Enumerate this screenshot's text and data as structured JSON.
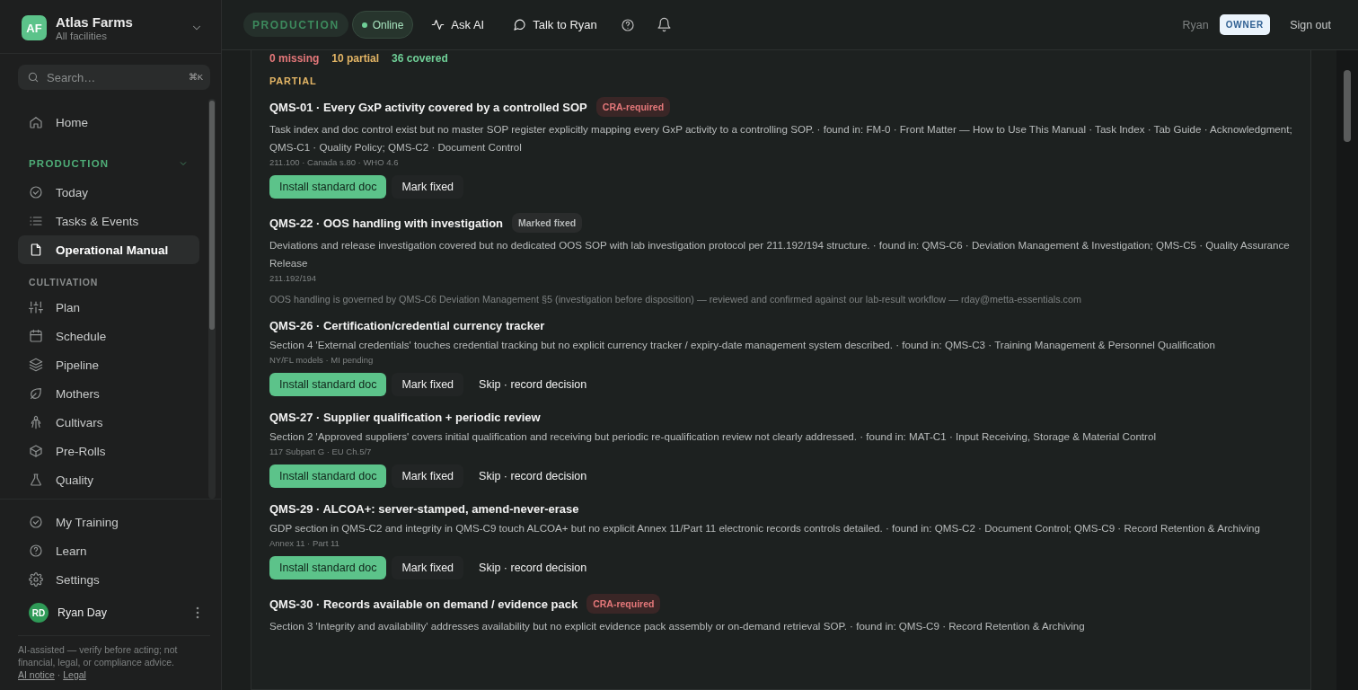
{
  "org": {
    "initials": "AF",
    "name": "Atlas Farms",
    "subtitle": "All facilities"
  },
  "search": {
    "placeholder": "Search…",
    "shortcut": "⌘K"
  },
  "nav": [
    {
      "kind": "item",
      "label": "Home",
      "selected": false
    },
    {
      "kind": "section",
      "label": "PRODUCTION",
      "expanded": true,
      "items": [
        {
          "label": "Today",
          "selected": false
        },
        {
          "label": "Tasks & Events",
          "selected": false
        },
        {
          "label": "Operational Manual",
          "selected": true
        }
      ]
    },
    {
      "kind": "section",
      "label": "CULTIVATION",
      "items": [
        {
          "label": "Plan",
          "selected": false
        },
        {
          "label": "Schedule",
          "selected": false
        },
        {
          "label": "Pipeline",
          "selected": false
        },
        {
          "label": "Mothers",
          "selected": false
        },
        {
          "label": "Cultivars",
          "selected": false
        },
        {
          "label": "Pre-Rolls",
          "selected": false
        },
        {
          "label": "Quality",
          "selected": false
        }
      ]
    }
  ],
  "bottom_nav": [
    {
      "label": "My Training",
      "selected": false
    },
    {
      "label": "Learn",
      "selected": false
    },
    {
      "label": "Settings",
      "selected": false
    }
  ],
  "user": {
    "initials": "RD",
    "name": "Ryan Day"
  },
  "disclaimer": "AI-assisted — verify before acting; not financial, legal, or compliance advice.",
  "footer_links": [
    "AI notice",
    "Legal"
  ],
  "footer_separator": "·",
  "topbar": {
    "mode": "PRODUCTION",
    "status": "Online",
    "online": true,
    "actions": [
      "Ask AI",
      "Talk to Ryan"
    ],
    "user": "Ryan",
    "role": "OWNER",
    "sign_out": "Sign out"
  },
  "summary": [
    {
      "label": "0 missing",
      "color": "#e5787a"
    },
    {
      "label": "10 partial",
      "color": "#e3b565"
    },
    {
      "label": "36 covered",
      "color": "#6fcf97"
    }
  ],
  "section_title": "PARTIAL",
  "gaps": [
    {
      "title": "QMS-01 · Every GxP activity covered by a controlled SOP",
      "badge": {
        "kind": "required",
        "label": "CRA-required"
      },
      "description": "Task index and doc control exist but no master SOP register explicitly mapping every GxP activity to a controlling SOP. · found in: FM-0 · Front Matter — How to Use This Manual · Task Index · Tab Guide · Acknowledgment; QMS-C1 · Quality Policy; QMS-C2 · Document Control",
      "refs": "211.100 · Canada s.80 · WHO 4.6",
      "actions": [
        {
          "kind": "primary",
          "label": "Install standard doc"
        },
        {
          "kind": "secondary",
          "label": "Mark fixed"
        }
      ]
    },
    {
      "title": "QMS-22 · OOS handling with investigation",
      "badge": {
        "kind": "fixed",
        "label": "Marked fixed"
      },
      "description": "Deviations and release investigation covered but no dedicated OOS SOP with lab investigation protocol per 211.192/194 structure. · found in: QMS-C6 · Deviation Management & Investigation; QMS-C5 · Quality Assurance Release",
      "refs": "211.192/194",
      "note": "OOS handling is governed by QMS-C6 Deviation Management §5 (investigation before disposition) — reviewed and confirmed against our lab-result workflow — rday@metta-essentials.com"
    },
    {
      "title": "QMS-26 · Certification/credential currency tracker",
      "description": "Section 4 'External credentials' touches credential tracking but no explicit currency tracker / expiry-date management system described. · found in: QMS-C3 · Training Management & Personnel Qualification",
      "refs": "NY/FL models · MI pending",
      "actions": [
        {
          "kind": "primary",
          "label": "Install standard doc"
        },
        {
          "kind": "secondary",
          "label": "Mark fixed"
        },
        {
          "kind": "plain",
          "label": "Skip · record decision"
        }
      ]
    },
    {
      "title": "QMS-27 · Supplier qualification + periodic review",
      "description": "Section 2 'Approved suppliers' covers initial qualification and receiving but periodic re-qualification review not clearly addressed. · found in: MAT-C1 · Input Receiving, Storage & Material Control",
      "refs": "117 Subpart G · EU Ch.5/7",
      "actions": [
        {
          "kind": "primary",
          "label": "Install standard doc"
        },
        {
          "kind": "secondary",
          "label": "Mark fixed"
        },
        {
          "kind": "plain",
          "label": "Skip · record decision"
        }
      ]
    },
    {
      "title": "QMS-29 · ALCOA+: server-stamped, amend-never-erase",
      "description": "GDP section in QMS-C2 and integrity in QMS-C9 touch ALCOA+ but no explicit Annex 11/Part 11 electronic records controls detailed. · found in: QMS-C2 · Document Control; QMS-C9 · Record Retention & Archiving",
      "refs": "Annex 11 · Part 11",
      "actions": [
        {
          "kind": "primary",
          "label": "Install standard doc"
        },
        {
          "kind": "secondary",
          "label": "Mark fixed"
        },
        {
          "kind": "plain",
          "label": "Skip · record decision"
        }
      ]
    },
    {
      "title": "QMS-30 · Records available on demand / evidence pack",
      "badge": {
        "kind": "required",
        "label": "CRA-required"
      },
      "description": "Section 3 'Integrity and availability' addresses availability but no explicit evidence pack assembly or on-demand retrieval SOP. · found in: QMS-C9 · Record Retention & Archiving"
    }
  ]
}
